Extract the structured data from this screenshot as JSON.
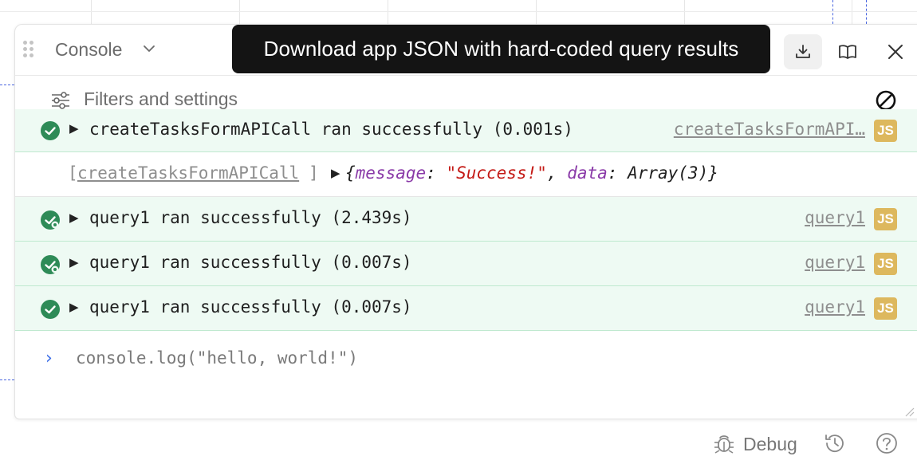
{
  "panel": {
    "title": "Console",
    "tooltip": "Download app JSON with hard-coded query results",
    "header_icons": [
      "download-icon",
      "book-icon",
      "close-icon"
    ]
  },
  "filters": {
    "label": "Filters and settings"
  },
  "logs": [
    {
      "status": "success",
      "text": "createTasksFormAPICall ran successfully (0.001s)",
      "source": "createTasksFormAPI…",
      "badge": "JS"
    },
    {
      "tag_open": "[",
      "tag_name": "createTasksFormAPICall",
      "tag_close": "]",
      "object": {
        "open": "{",
        "key1": "message",
        "sep1": ": ",
        "val1": "\"Success!\"",
        "comma": ", ",
        "key2": "data",
        "sep2": ": ",
        "val2": "Array(3)",
        "close": "}"
      }
    },
    {
      "status": "success-pending",
      "text": "query1 ran successfully (2.439s)",
      "source": "query1",
      "badge": "JS"
    },
    {
      "status": "success-pending",
      "text": "query1 ran successfully (0.007s)",
      "source": "query1",
      "badge": "JS"
    },
    {
      "status": "success",
      "text": "query1 ran successfully (0.007s)",
      "source": "query1",
      "badge": "JS"
    }
  ],
  "prompt": {
    "caret": "›",
    "value": "console.log(\"hello, world!\")"
  },
  "bottom_bar": {
    "debug_label": "Debug",
    "icons": [
      "bug-icon",
      "history-icon",
      "help-icon"
    ]
  },
  "colors": {
    "success_green": "#2e8b57",
    "success_bg": "#eefaf3",
    "js_badge": "#ddb85e",
    "tooltip_bg": "#141414",
    "prompt_caret": "#3b6ee8"
  }
}
